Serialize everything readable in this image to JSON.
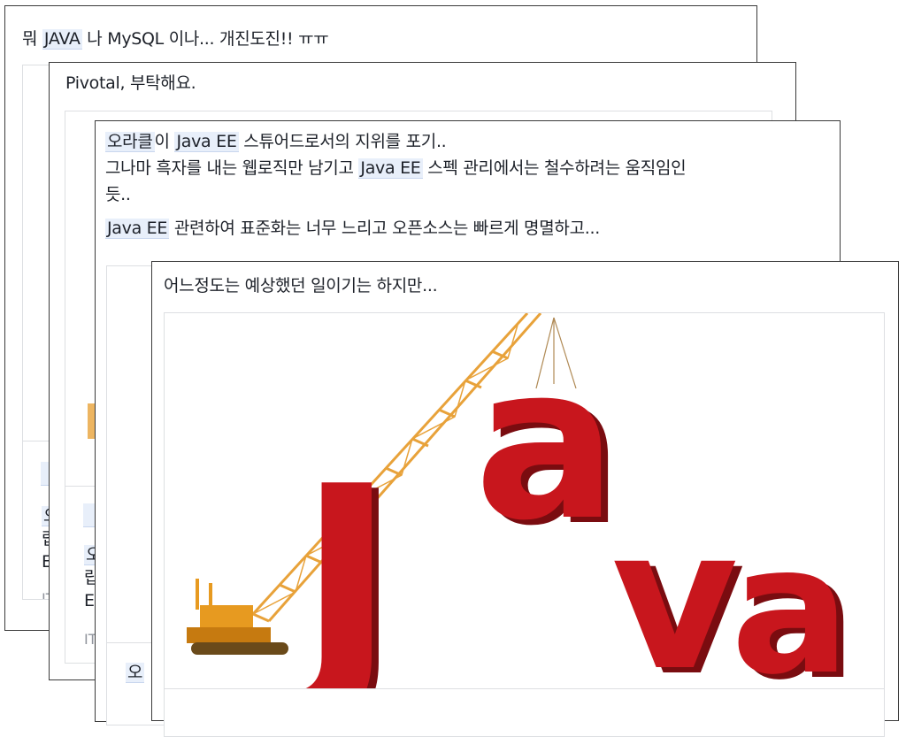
{
  "posts": [
    {
      "text_parts": [
        "뭐 ",
        "JAVA",
        " 나 MySQL 이나... 개진도진!! ㅠㅠ"
      ],
      "preview_fragments": [
        "오",
        "랍",
        "E",
        "IT"
      ]
    },
    {
      "text": "Pivotal, 부탁해요.",
      "preview_fragments": [
        "오",
        "랍",
        "E",
        "IT"
      ]
    },
    {
      "line1": [
        "오라클",
        "이 ",
        "Java EE",
        " 스튜어드로서의 지위를 포기.."
      ],
      "line2": [
        "그나마 흑자를 내는 웹로직만 남기고 ",
        "Java EE",
        " 스펙 관리에서는 철수하려는 움직임인"
      ],
      "line3": "듯..",
      "line4": [
        "Java EE",
        " 관련하여 표준화는 너무 느리고 오픈소스는 빠르게 명멸하고..."
      ],
      "preview_fragments": [
        "오"
      ]
    },
    {
      "text": "어느정도는 예상했던 일이기는 하지만...",
      "image_logo_text": "Java"
    }
  ],
  "colors": {
    "highlight": "#e8effa",
    "java_red": "#c8161d",
    "crane": "#e8a23a"
  }
}
